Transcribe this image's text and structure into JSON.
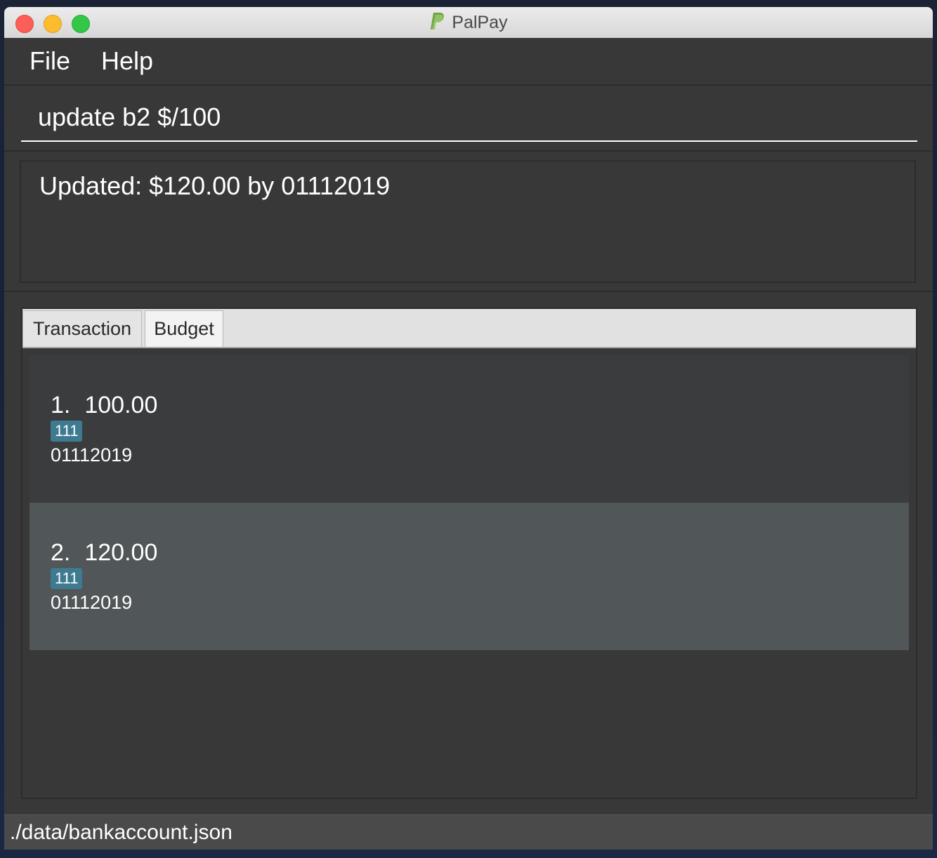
{
  "window": {
    "title": "PalPay",
    "logo_icon": "paypal-logo-icon"
  },
  "menu": {
    "file": "File",
    "help": "Help"
  },
  "command": {
    "value": "update b2 $/100"
  },
  "result": {
    "message": "Updated: $120.00 by 01112019"
  },
  "tabs": [
    {
      "label": "Transaction",
      "selected": false
    },
    {
      "label": "Budget",
      "selected": true
    }
  ],
  "budgets": [
    {
      "index": "1.",
      "amount": "100.00",
      "tag": "111",
      "date": "01112019"
    },
    {
      "index": "2.",
      "amount": "120.00",
      "tag": "111",
      "date": "01112019"
    }
  ],
  "status": {
    "path": "./data/bankaccount.json"
  },
  "colors": {
    "tag_bg": "#3e7b91",
    "selected_card": "#515659",
    "background": "#383838"
  }
}
